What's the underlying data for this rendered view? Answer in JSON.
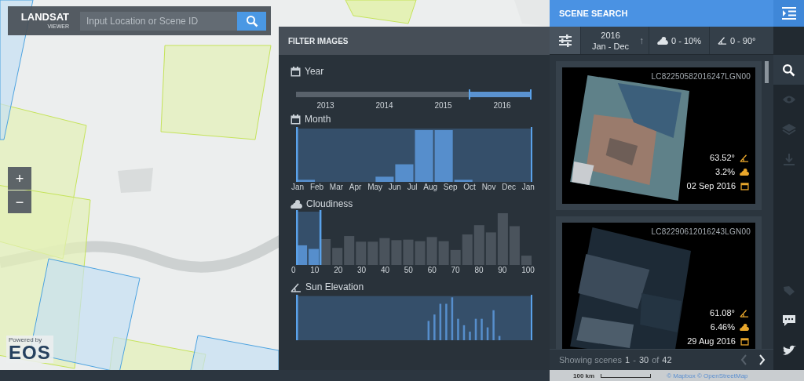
{
  "header": {
    "brand": "LANDSAT",
    "sub": "VIEWER",
    "search_placeholder": "Input Location or Scene ID"
  },
  "zoom": [
    "+",
    "−"
  ],
  "credit": {
    "powered_by": "Powered by",
    "logo": "EOS"
  },
  "filter_panel": {
    "title": "FILTER IMAGES",
    "sections": [
      {
        "kind": "range",
        "title": "Year",
        "ticks": [
          "2013",
          "2014",
          "2015",
          "2016"
        ],
        "handles": [
          {
            "level": 0.74
          },
          {
            "level": 1
          }
        ]
      },
      {
        "kind": "histogram",
        "title": "Month",
        "ticks": [
          "Jan",
          "Feb",
          "Mar",
          "Apr",
          "May",
          "Jun",
          "Jul",
          "Aug",
          "Sep",
          "Oct",
          "Nov",
          "Dec",
          "Jan"
        ],
        "handles": [
          {
            "level": 0
          },
          {
            "level": 1
          }
        ]
      },
      {
        "kind": "histogram",
        "title": "Cloudiness",
        "ticks": [
          "0",
          "10",
          "20",
          "30",
          "40",
          "50",
          "60",
          "70",
          "80",
          "90",
          "100"
        ],
        "handles": [
          {
            "level": 0
          },
          {
            "level": 0.1
          }
        ]
      },
      {
        "kind": "histogram",
        "title": "Sun Elevation",
        "handles": [
          {
            "level": 0
          },
          {
            "level": 1
          }
        ]
      }
    ]
  },
  "scene_search": {
    "title": "SCENE SEARCH",
    "filters": {
      "year": "2016",
      "months": "Jan - Dec",
      "sort_glyph": "↑",
      "cloud": "0 - 10%",
      "sun": "0 - 90°"
    },
    "scenes": [
      {
        "id": "LC82250582016247LGN00",
        "sun_elevation": "63.52°",
        "cloud": "3.2%",
        "date": "02 Sep 2016"
      },
      {
        "id": "LC82290612016243LGN00",
        "sun_elevation": "61.08°",
        "cloud": "6.46%",
        "date": "29 Aug 2016"
      }
    ],
    "pagination": {
      "parts": [
        {
          "kind": "label",
          "text": "Showing scenes"
        },
        {
          "kind": "number",
          "text": "1"
        },
        {
          "kind": "label",
          "text": "-"
        },
        {
          "kind": "number",
          "text": "30"
        },
        {
          "kind": "label",
          "text": "of"
        },
        {
          "kind": "number",
          "text": "42"
        }
      ],
      "prev_disabled": true,
      "next_disabled": false
    }
  },
  "tools": [
    {
      "selected": true,
      "disabled": false
    },
    {
      "selected": false,
      "disabled": true
    },
    {
      "selected": false,
      "disabled": true
    },
    {
      "selected": false,
      "disabled": true
    },
    {
      "selected": false,
      "disabled": true
    },
    {
      "selected": false,
      "disabled": false
    },
    {
      "selected": false,
      "disabled": false
    }
  ],
  "map_footer": {
    "scale": "100 km",
    "attribution": "© Mapbox © OpenStreetMap"
  }
}
